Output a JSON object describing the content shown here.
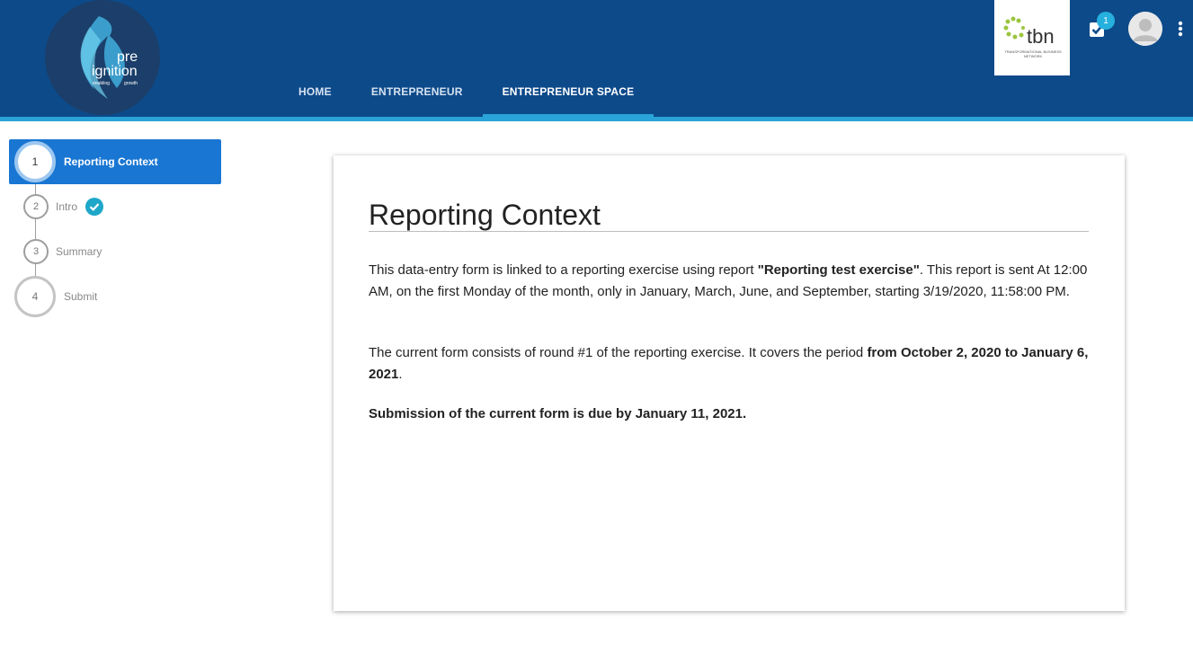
{
  "brand": {
    "logo_main": "pre",
    "logo_sub": "ignition",
    "logo_tag1": "enabling",
    "logo_tag2": "growth",
    "partner_logo_text": "tbn",
    "partner_logo_sub": "TRANSFORMATIONAL BUSINESS NETWORK",
    "accent_color": "#0d4a8a",
    "highlight_color": "#2aa4d8"
  },
  "nav": {
    "tabs": [
      {
        "label": "HOME"
      },
      {
        "label": "ENTREPRENEUR"
      },
      {
        "label": "ENTREPRENEUR SPACE",
        "active": true
      }
    ]
  },
  "toolbar": {
    "tasks_icon": "task-check-icon",
    "tasks_badge": "1",
    "avatar_icon": "user-avatar-icon",
    "menu_icon": "more-vertical-icon"
  },
  "steps": [
    {
      "number": "1",
      "label": "Reporting Context",
      "active": true
    },
    {
      "number": "2",
      "label": "Intro",
      "completed": true
    },
    {
      "number": "3",
      "label": "Summary"
    },
    {
      "number": "4",
      "label": "Submit"
    }
  ],
  "content": {
    "title": "Reporting Context",
    "p1_a": "This data-entry form is linked to a reporting exercise using report ",
    "p1_b": "\"Reporting test exercise\"",
    "p1_c": ". This report is sent At 12:00 AM, on the first Monday of the month, only in January, March, June, and September, starting 3/19/2020, 11:58:00 PM.",
    "p2_a": "The current form consists of round #1 of the reporting exercise. It covers the period ",
    "p2_b": "from October 2, 2020 to January 6, 2021",
    "p2_c": ".",
    "p3": "Submission of the current form is due by January 11, 2021."
  }
}
